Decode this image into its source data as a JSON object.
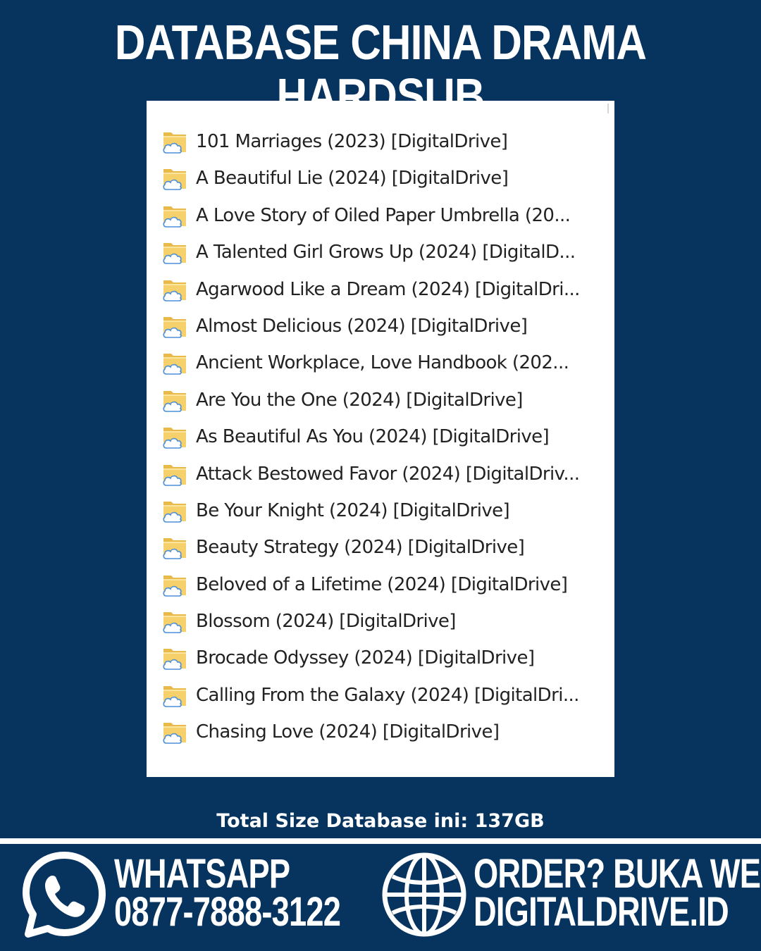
{
  "header": {
    "title": "DATABASE CHINA DRAMA HARDSUB"
  },
  "folders": [
    {
      "name": "101 Marriages (2023) [DigitalDrive]",
      "icon": "cloud-folder-icon"
    },
    {
      "name": "A Beautiful Lie (2024) [DigitalDrive]",
      "icon": "cloud-folder-icon"
    },
    {
      "name": "A Love Story of Oiled Paper Umbrella (20...",
      "icon": "cloud-folder-icon"
    },
    {
      "name": "A Talented Girl Grows Up (2024) [DigitalD...",
      "icon": "cloud-folder-icon"
    },
    {
      "name": "Agarwood Like a Dream (2024) [DigitalDri...",
      "icon": "cloud-folder-icon"
    },
    {
      "name": "Almost Delicious (2024) [DigitalDrive]",
      "icon": "cloud-folder-icon"
    },
    {
      "name": "Ancient Workplace, Love Handbook (202...",
      "icon": "cloud-folder-icon"
    },
    {
      "name": "Are You the One (2024) [DigitalDrive]",
      "icon": "cloud-folder-icon"
    },
    {
      "name": "As Beautiful As You (2024) [DigitalDrive]",
      "icon": "cloud-folder-icon"
    },
    {
      "name": "Attack Bestowed Favor (2024) [DigitalDriv...",
      "icon": "cloud-folder-icon"
    },
    {
      "name": "Be Your Knight (2024) [DigitalDrive]",
      "icon": "cloud-folder-icon"
    },
    {
      "name": "Beauty Strategy (2024) [DigitalDrive]",
      "icon": "cloud-folder-icon"
    },
    {
      "name": "Beloved of a Lifetime (2024) [DigitalDrive]",
      "icon": "cloud-folder-icon"
    },
    {
      "name": "Blossom (2024) [DigitalDrive]",
      "icon": "cloud-folder-icon"
    },
    {
      "name": "Brocade Odyssey (2024) [DigitalDrive]",
      "icon": "cloud-folder-icon"
    },
    {
      "name": "Calling From the Galaxy (2024) [DigitalDri...",
      "icon": "cloud-folder-icon"
    },
    {
      "name": "Chasing Love (2024) [DigitalDrive]",
      "icon": "cloud-folder-icon"
    }
  ],
  "summary": {
    "total_size": "Total Size Database ini: 137GB"
  },
  "footer": {
    "whatsapp_label": "WHATSAPP",
    "whatsapp_number": "0877-7888-3122",
    "order_label": "ORDER? BUKA WEB",
    "website": "DIGITALDRIVE.ID",
    "whatsapp_icon": "whatsapp-icon",
    "globe_icon": "globe-icon"
  },
  "colors": {
    "background": "#07335f",
    "panel": "#ffffff",
    "text_light": "#ffffff",
    "folder_yellow": "#f6d16b",
    "cloud_blue": "#4a8fd8"
  }
}
